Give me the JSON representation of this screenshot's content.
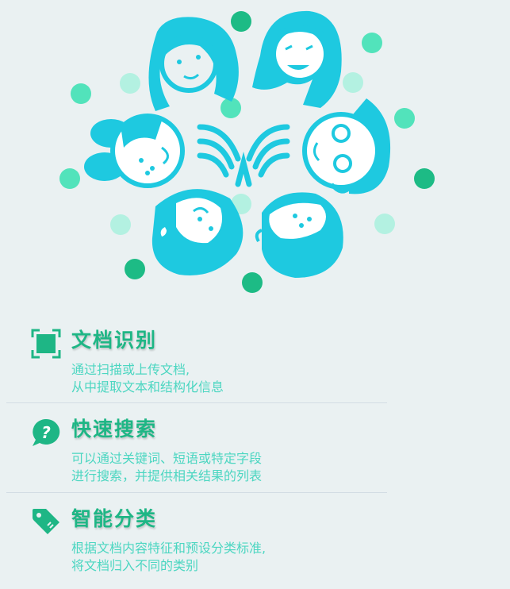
{
  "colors": {
    "background": "#eaf1f2",
    "title_green": "#1eb685",
    "desc_teal": "#4cd6c1",
    "illustration_cyan": "#1ec9e0",
    "dot_dark": "#1dbb85",
    "dot_mid": "#52e3bb",
    "dot_light": "#b3f1e1"
  },
  "features": [
    {
      "title": "文档识别",
      "icon": "scan-frame-icon",
      "desc_line1": "通过扫描或上传文档,",
      "desc_line2": "从中提取文本和结构化信息"
    },
    {
      "title": "快速搜索",
      "icon": "question-bubble-icon",
      "desc_line1": "可以通过关键词、短语或特定字段",
      "desc_line2": "进行搜索，并提供相关结果的列表"
    },
    {
      "title": "智能分类",
      "icon": "tag-icon",
      "desc_line1": "根据文档内容特征和预设分类标准,",
      "desc_line2": "将文档归入不同的类别"
    }
  ],
  "illustration": {
    "subject": "six-faces-around-logo"
  }
}
